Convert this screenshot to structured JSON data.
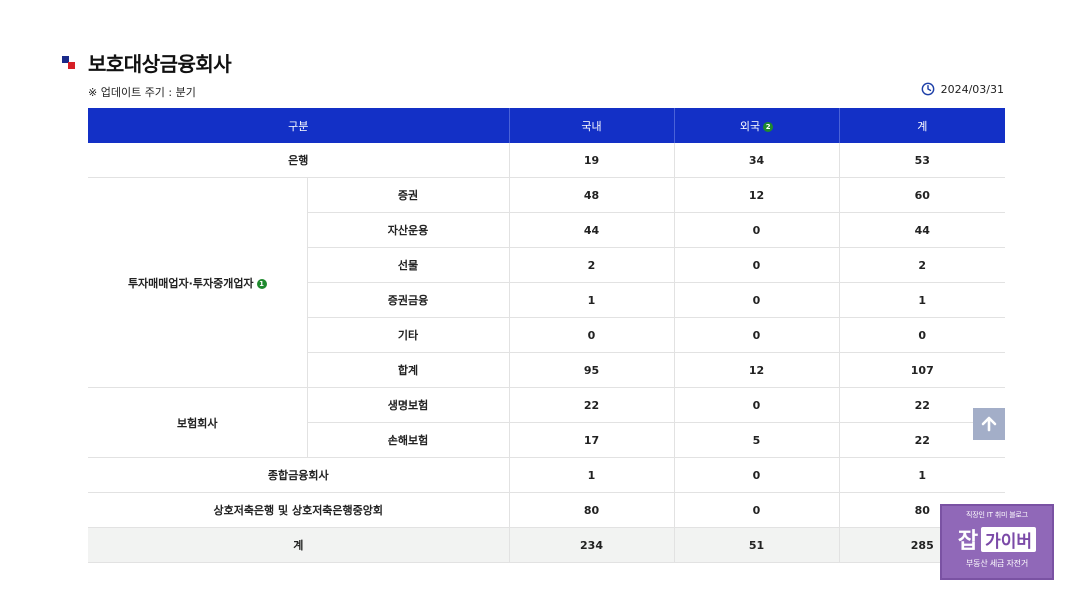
{
  "header": {
    "title": "보호대상금융회사",
    "update_note": "※ 업데이트 주기 : 분기",
    "date": "2024/03/31"
  },
  "table": {
    "columns": {
      "category": "구분",
      "domestic": "국내",
      "foreign": "외국",
      "foreign_badge": "2",
      "total": "계"
    },
    "rows": {
      "bank": {
        "label": "은행",
        "domestic": "19",
        "foreign": "34",
        "total": "53"
      },
      "invest": {
        "label": "투자매매업자·투자중개업자",
        "badge": "1",
        "items": [
          {
            "label": "증권",
            "domestic": "48",
            "foreign": "12",
            "total": "60"
          },
          {
            "label": "자산운용",
            "domestic": "44",
            "foreign": "0",
            "total": "44"
          },
          {
            "label": "선물",
            "domestic": "2",
            "foreign": "0",
            "total": "2"
          },
          {
            "label": "증권금융",
            "domestic": "1",
            "foreign": "0",
            "total": "1"
          },
          {
            "label": "기타",
            "domestic": "0",
            "foreign": "0",
            "total": "0"
          },
          {
            "label": "합계",
            "domestic": "95",
            "foreign": "12",
            "total": "107"
          }
        ]
      },
      "insurance": {
        "label": "보험회사",
        "items": [
          {
            "label": "생명보험",
            "domestic": "22",
            "foreign": "0",
            "total": "22"
          },
          {
            "label": "손해보험",
            "domestic": "17",
            "foreign": "5",
            "total": "22"
          }
        ]
      },
      "general": {
        "label": "종합금융회사",
        "domestic": "1",
        "foreign": "0",
        "total": "1"
      },
      "savings": {
        "label": "상호저축은행 및 상호저축은행중앙회",
        "domestic": "80",
        "foreign": "0",
        "total": "80"
      },
      "grand_total": {
        "label": "계",
        "domestic": "234",
        "foreign": "51",
        "total": "285"
      }
    }
  },
  "ad": {
    "top": "직장인 IT 취미 블로그",
    "main_big": "잡",
    "main_box": "가이버",
    "bottom": "부동산 세금 자전거"
  },
  "icons": {
    "clock": "clock-icon",
    "scroll_top": "arrow-up-icon"
  },
  "colors": {
    "header_bg": "#1330c6",
    "badge_green": "#1f8a2e",
    "total_row_bg": "#f2f3f2",
    "ad_bg": "#9068b8"
  }
}
